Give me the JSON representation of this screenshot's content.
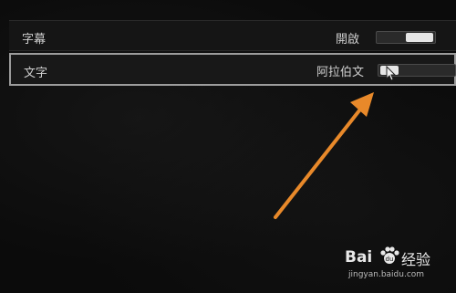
{
  "settings": {
    "rows": [
      {
        "label": "字幕",
        "value": "開啟",
        "slider_level": 1.0,
        "selected": false
      },
      {
        "label": "文字",
        "value": "阿拉伯文",
        "slider_level": 0.0,
        "selected": true
      }
    ]
  },
  "annotation": {
    "color": "#e8892a"
  },
  "watermark": {
    "brand": "Bai",
    "name": "经验",
    "url": "jingyan.baidu.com"
  }
}
